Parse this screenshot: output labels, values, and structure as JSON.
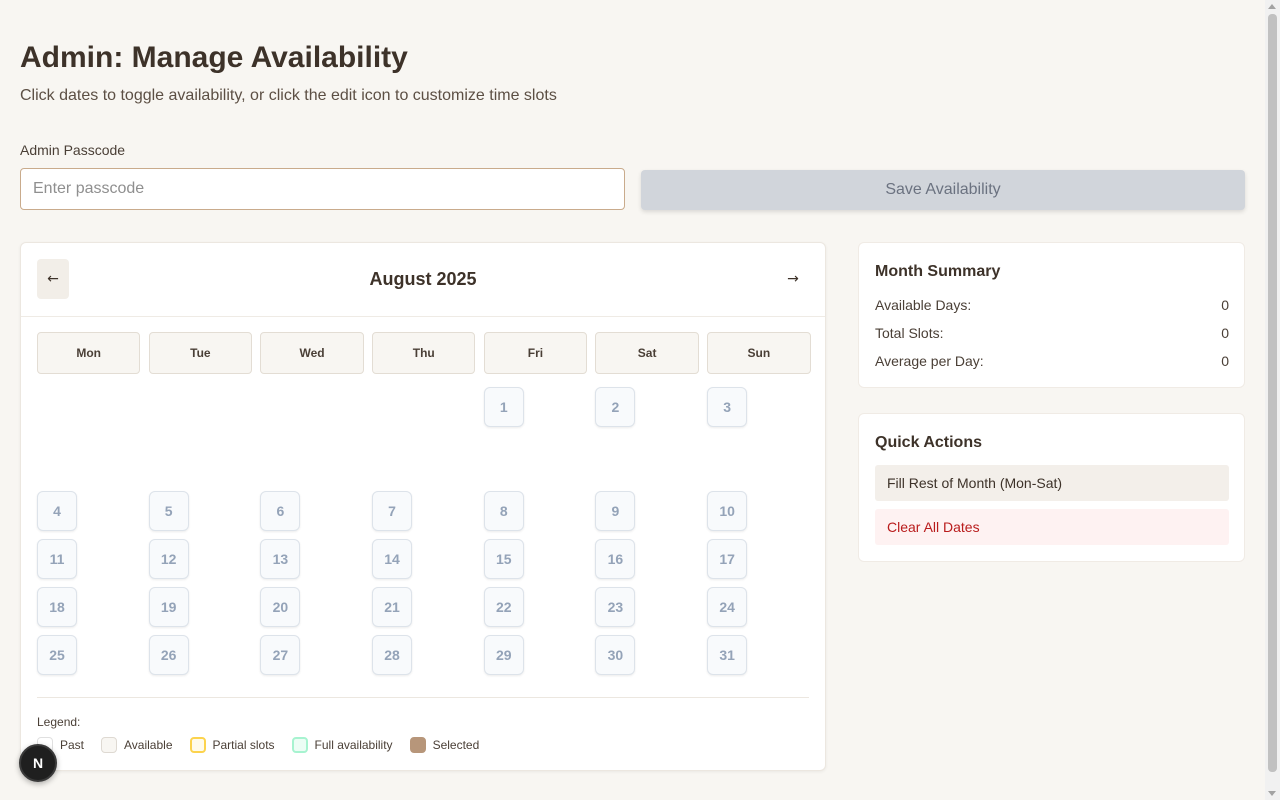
{
  "header": {
    "title": "Admin: Manage Availability",
    "subtitle": "Click dates to toggle availability, or click the edit icon to customize time slots"
  },
  "passcode": {
    "label": "Admin Passcode",
    "placeholder": "Enter passcode",
    "value": ""
  },
  "save_button": "Save Availability",
  "calendar": {
    "month_title": "August 2025",
    "prev_icon": "←",
    "next_icon": "→",
    "weekdays": [
      "Mon",
      "Tue",
      "Wed",
      "Thu",
      "Fri",
      "Sat",
      "Sun"
    ],
    "weeks": [
      [
        "",
        "",
        "",
        "",
        "1",
        "2",
        "3"
      ],
      [
        "4",
        "5",
        "6",
        "7",
        "8",
        "9",
        "10"
      ],
      [
        "11",
        "12",
        "13",
        "14",
        "15",
        "16",
        "17"
      ],
      [
        "18",
        "19",
        "20",
        "21",
        "22",
        "23",
        "24"
      ],
      [
        "25",
        "26",
        "27",
        "28",
        "29",
        "30",
        "31"
      ]
    ],
    "legend_title": "Legend:",
    "legend": [
      "Past",
      "Available",
      "Partial slots",
      "Full availability",
      "Selected"
    ]
  },
  "summary": {
    "title": "Month Summary",
    "rows": [
      {
        "label": "Available Days:",
        "value": "0"
      },
      {
        "label": "Total Slots:",
        "value": "0"
      },
      {
        "label": "Average per Day:",
        "value": "0"
      }
    ]
  },
  "quick_actions": {
    "title": "Quick Actions",
    "fill_label": "Fill Rest of Month (Mon-Sat)",
    "clear_label": "Clear All Dates"
  },
  "badge_letter": "N",
  "colors": {
    "background": "#f8f6f2",
    "accent": "#b7967a",
    "danger": "#b91c1c"
  }
}
